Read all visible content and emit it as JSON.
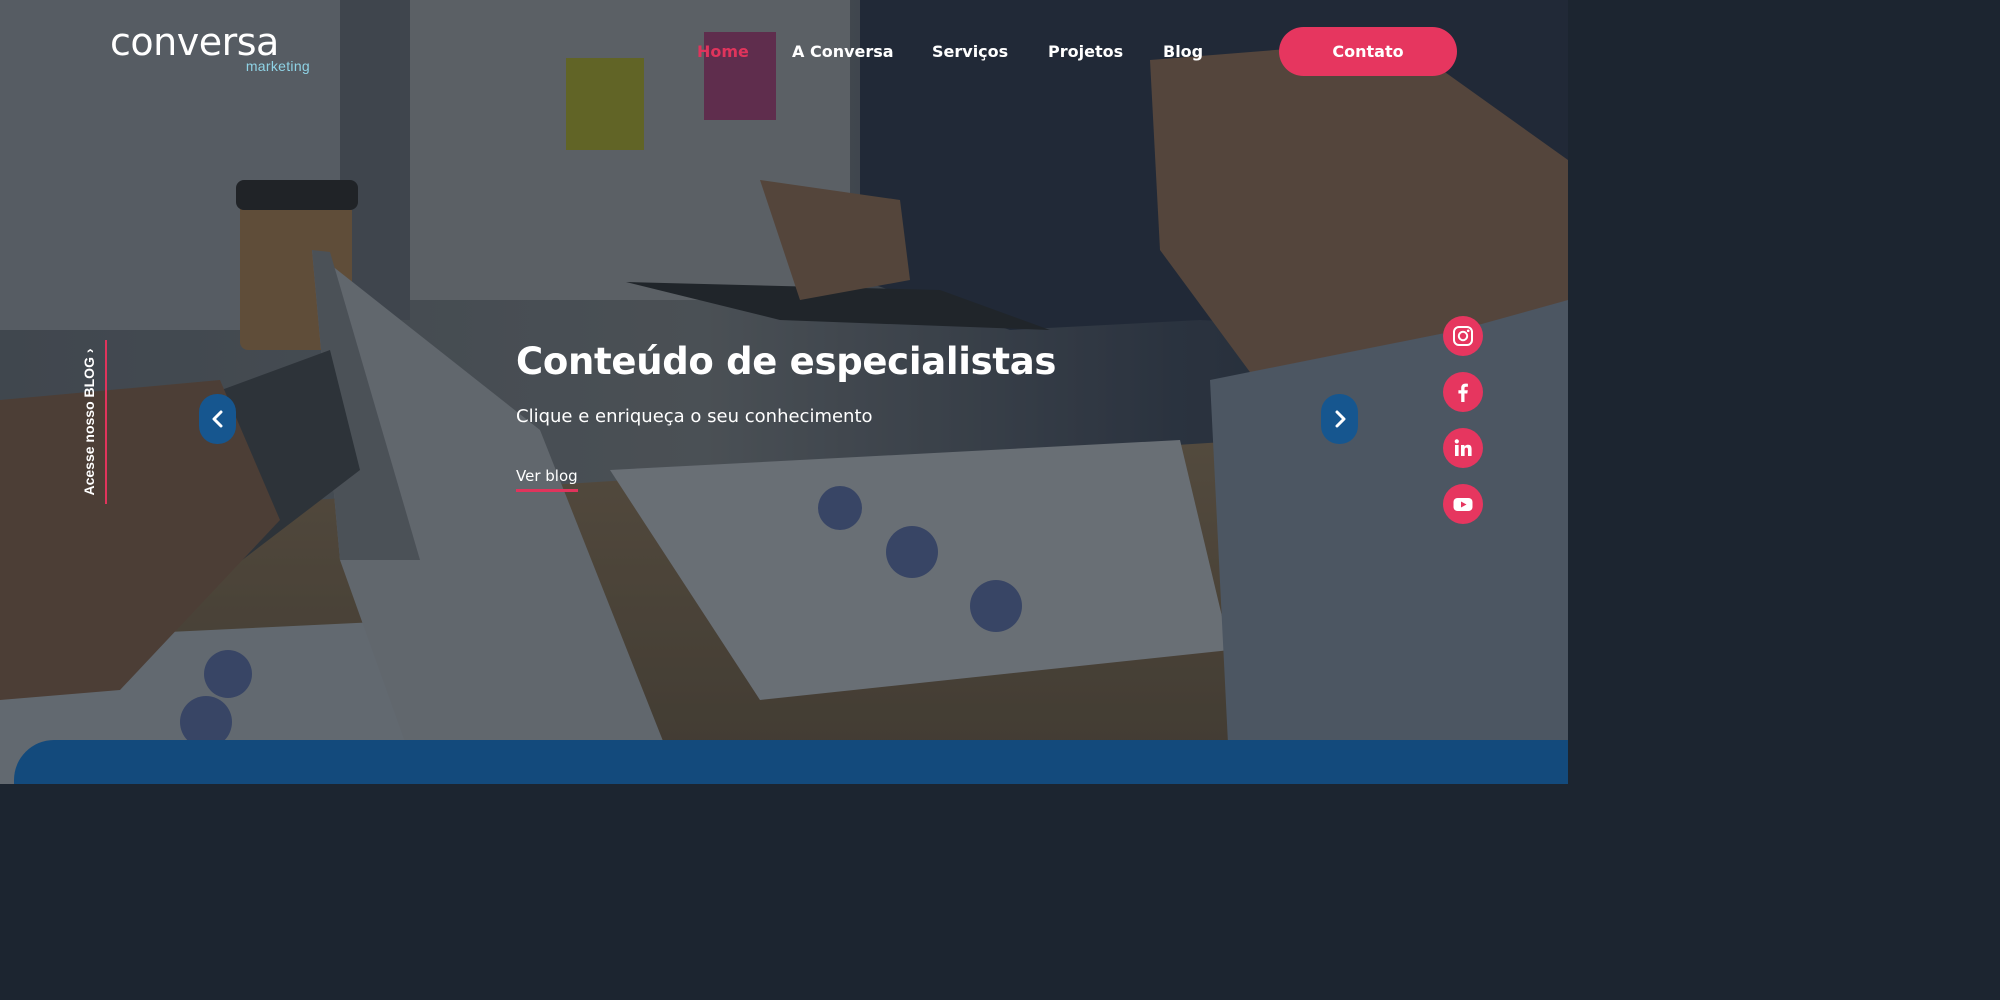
{
  "brand": {
    "name": "conversa",
    "tagline": "marketing"
  },
  "nav": {
    "items": [
      {
        "label": "Home",
        "active": true
      },
      {
        "label": "A Conversa",
        "active": false
      },
      {
        "label": "Serviços",
        "active": false
      },
      {
        "label": "Projetos",
        "active": false
      },
      {
        "label": "Blog",
        "active": false
      }
    ],
    "cta_label": "Contato"
  },
  "side": {
    "blog_label": "Acesse nosso BLOG ›"
  },
  "hero": {
    "title": "Conteúdo de especialistas",
    "subtitle": "Clique e enriqueça o seu conhecimento",
    "link_label": "Ver blog"
  },
  "social": [
    "instagram-icon",
    "facebook-icon",
    "linkedin-icon",
    "youtube-icon"
  ],
  "colors": {
    "accent": "#e6365f",
    "navy": "#134a7c",
    "arrow_bg": "#16568f",
    "logo_sub": "#8fd3e6"
  }
}
